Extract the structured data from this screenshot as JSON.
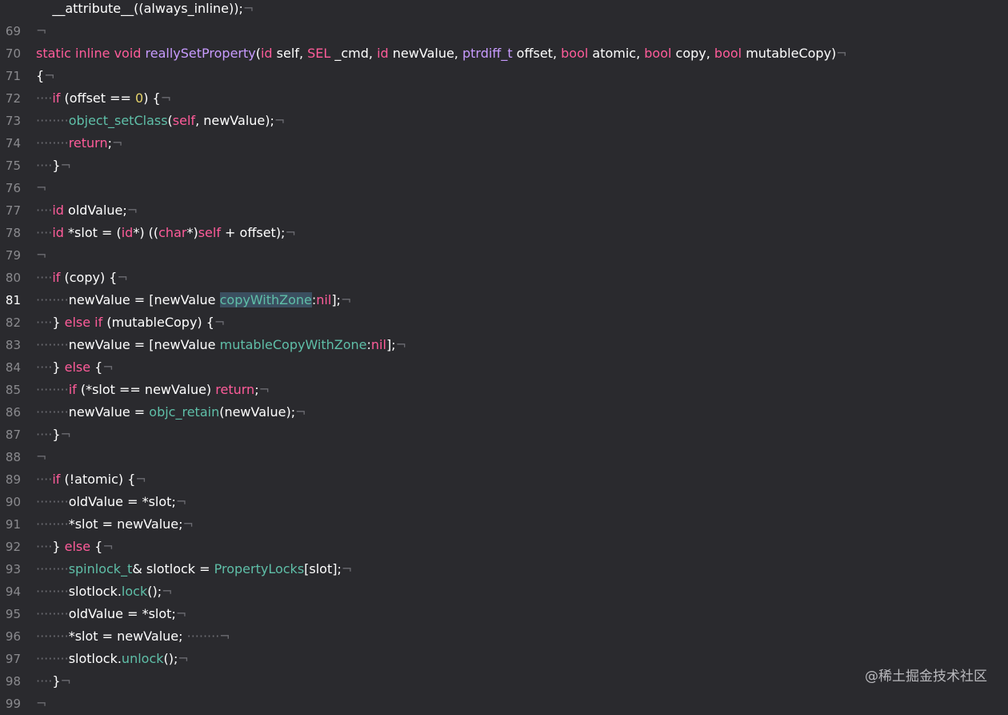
{
  "editor": {
    "current_line": "81",
    "lines": [
      {
        "n": "",
        "tokens": [
          {
            "t": "    __attribute__((always_inline));",
            "c": "pl"
          },
          {
            "t": "¬",
            "c": "inv"
          }
        ]
      },
      {
        "n": "69",
        "tokens": [
          {
            "t": "¬",
            "c": "inv"
          }
        ]
      },
      {
        "n": "70",
        "tokens": [
          {
            "t": "static inline void ",
            "c": "kw"
          },
          {
            "t": "reallySetProperty",
            "c": "ty"
          },
          {
            "t": "(",
            "c": "pl"
          },
          {
            "t": "id",
            "c": "kw"
          },
          {
            "t": " self, ",
            "c": "pl"
          },
          {
            "t": "SEL",
            "c": "kw"
          },
          {
            "t": " _cmd, ",
            "c": "pl"
          },
          {
            "t": "id",
            "c": "kw"
          },
          {
            "t": " newValue, ",
            "c": "pl"
          },
          {
            "t": "ptrdiff_t",
            "c": "ty"
          },
          {
            "t": " offset, ",
            "c": "pl"
          },
          {
            "t": "bool",
            "c": "kw"
          },
          {
            "t": " atomic, ",
            "c": "pl"
          },
          {
            "t": "bool",
            "c": "kw"
          },
          {
            "t": " copy, ",
            "c": "pl"
          },
          {
            "t": "bool",
            "c": "kw"
          },
          {
            "t": " mutableCopy)",
            "c": "pl"
          },
          {
            "t": "¬",
            "c": "inv"
          }
        ]
      },
      {
        "n": "71",
        "tokens": [
          {
            "t": "{",
            "c": "pl"
          },
          {
            "t": "¬",
            "c": "inv"
          }
        ]
      },
      {
        "n": "72",
        "tokens": [
          {
            "t": "····",
            "c": "inv"
          },
          {
            "t": "if",
            "c": "kw"
          },
          {
            "t": " (offset == ",
            "c": "pl"
          },
          {
            "t": "0",
            "c": "num"
          },
          {
            "t": ") {",
            "c": "pl"
          },
          {
            "t": "¬",
            "c": "inv"
          }
        ]
      },
      {
        "n": "73",
        "tokens": [
          {
            "t": "········",
            "c": "inv"
          },
          {
            "t": "object_setClass",
            "c": "fn"
          },
          {
            "t": "(",
            "c": "pl"
          },
          {
            "t": "self",
            "c": "kw"
          },
          {
            "t": ", newValue);",
            "c": "pl"
          },
          {
            "t": "¬",
            "c": "inv"
          }
        ]
      },
      {
        "n": "74",
        "tokens": [
          {
            "t": "········",
            "c": "inv"
          },
          {
            "t": "return",
            "c": "kw"
          },
          {
            "t": ";",
            "c": "pl"
          },
          {
            "t": "¬",
            "c": "inv"
          }
        ]
      },
      {
        "n": "75",
        "tokens": [
          {
            "t": "····",
            "c": "inv"
          },
          {
            "t": "}",
            "c": "pl"
          },
          {
            "t": "¬",
            "c": "inv"
          }
        ]
      },
      {
        "n": "76",
        "tokens": [
          {
            "t": "¬",
            "c": "inv"
          }
        ]
      },
      {
        "n": "77",
        "tokens": [
          {
            "t": "····",
            "c": "inv"
          },
          {
            "t": "id",
            "c": "kw"
          },
          {
            "t": " oldValue;",
            "c": "pl"
          },
          {
            "t": "¬",
            "c": "inv"
          }
        ]
      },
      {
        "n": "78",
        "tokens": [
          {
            "t": "····",
            "c": "inv"
          },
          {
            "t": "id",
            "c": "kw"
          },
          {
            "t": " *slot = (",
            "c": "pl"
          },
          {
            "t": "id",
            "c": "kw"
          },
          {
            "t": "*) ((",
            "c": "pl"
          },
          {
            "t": "char",
            "c": "kw"
          },
          {
            "t": "*)",
            "c": "pl"
          },
          {
            "t": "self",
            "c": "kw"
          },
          {
            "t": " + offset);",
            "c": "pl"
          },
          {
            "t": "¬",
            "c": "inv"
          }
        ]
      },
      {
        "n": "79",
        "tokens": [
          {
            "t": "¬",
            "c": "inv"
          }
        ]
      },
      {
        "n": "80",
        "tokens": [
          {
            "t": "····",
            "c": "inv"
          },
          {
            "t": "if",
            "c": "kw"
          },
          {
            "t": " (copy) {",
            "c": "pl"
          },
          {
            "t": "¬",
            "c": "inv"
          }
        ]
      },
      {
        "n": "81",
        "tokens": [
          {
            "t": "········",
            "c": "inv"
          },
          {
            "t": "newValue = [newValue ",
            "c": "pl"
          },
          {
            "t": "copyWithZone",
            "c": "fn sel"
          },
          {
            "t": ":",
            "c": "pl"
          },
          {
            "t": "nil",
            "c": "kw"
          },
          {
            "t": "];",
            "c": "pl"
          },
          {
            "t": "¬",
            "c": "inv"
          }
        ]
      },
      {
        "n": "82",
        "tokens": [
          {
            "t": "····",
            "c": "inv"
          },
          {
            "t": "} ",
            "c": "pl"
          },
          {
            "t": "else if",
            "c": "kw"
          },
          {
            "t": " (mutableCopy) {",
            "c": "pl"
          },
          {
            "t": "¬",
            "c": "inv"
          }
        ]
      },
      {
        "n": "83",
        "tokens": [
          {
            "t": "········",
            "c": "inv"
          },
          {
            "t": "newValue = [newValue ",
            "c": "pl"
          },
          {
            "t": "mutableCopyWithZone",
            "c": "fn"
          },
          {
            "t": ":",
            "c": "pl"
          },
          {
            "t": "nil",
            "c": "kw"
          },
          {
            "t": "];",
            "c": "pl"
          },
          {
            "t": "¬",
            "c": "inv"
          }
        ]
      },
      {
        "n": "84",
        "tokens": [
          {
            "t": "····",
            "c": "inv"
          },
          {
            "t": "} ",
            "c": "pl"
          },
          {
            "t": "else",
            "c": "kw"
          },
          {
            "t": " {",
            "c": "pl"
          },
          {
            "t": "¬",
            "c": "inv"
          }
        ]
      },
      {
        "n": "85",
        "tokens": [
          {
            "t": "········",
            "c": "inv"
          },
          {
            "t": "if",
            "c": "kw"
          },
          {
            "t": " (*slot == newValue) ",
            "c": "pl"
          },
          {
            "t": "return",
            "c": "kw"
          },
          {
            "t": ";",
            "c": "pl"
          },
          {
            "t": "¬",
            "c": "inv"
          }
        ]
      },
      {
        "n": "86",
        "tokens": [
          {
            "t": "········",
            "c": "inv"
          },
          {
            "t": "newValue = ",
            "c": "pl"
          },
          {
            "t": "objc_retain",
            "c": "fn"
          },
          {
            "t": "(newValue);",
            "c": "pl"
          },
          {
            "t": "¬",
            "c": "inv"
          }
        ]
      },
      {
        "n": "87",
        "tokens": [
          {
            "t": "····",
            "c": "inv"
          },
          {
            "t": "}",
            "c": "pl"
          },
          {
            "t": "¬",
            "c": "inv"
          }
        ]
      },
      {
        "n": "88",
        "tokens": [
          {
            "t": "¬",
            "c": "inv"
          }
        ]
      },
      {
        "n": "89",
        "tokens": [
          {
            "t": "····",
            "c": "inv"
          },
          {
            "t": "if",
            "c": "kw"
          },
          {
            "t": " (!atomic) {",
            "c": "pl"
          },
          {
            "t": "¬",
            "c": "inv"
          }
        ]
      },
      {
        "n": "90",
        "tokens": [
          {
            "t": "········",
            "c": "inv"
          },
          {
            "t": "oldValue = *slot;",
            "c": "pl"
          },
          {
            "t": "¬",
            "c": "inv"
          }
        ]
      },
      {
        "n": "91",
        "tokens": [
          {
            "t": "········",
            "c": "inv"
          },
          {
            "t": "*slot = newValue;",
            "c": "pl"
          },
          {
            "t": "¬",
            "c": "inv"
          }
        ]
      },
      {
        "n": "92",
        "tokens": [
          {
            "t": "····",
            "c": "inv"
          },
          {
            "t": "} ",
            "c": "pl"
          },
          {
            "t": "else",
            "c": "kw"
          },
          {
            "t": " {",
            "c": "pl"
          },
          {
            "t": "¬",
            "c": "inv"
          }
        ]
      },
      {
        "n": "93",
        "tokens": [
          {
            "t": "········",
            "c": "inv"
          },
          {
            "t": "spinlock_t",
            "c": "fn"
          },
          {
            "t": "& slotlock = ",
            "c": "pl"
          },
          {
            "t": "PropertyLocks",
            "c": "fn"
          },
          {
            "t": "[slot];",
            "c": "pl"
          },
          {
            "t": "¬",
            "c": "inv"
          }
        ]
      },
      {
        "n": "94",
        "tokens": [
          {
            "t": "········",
            "c": "inv"
          },
          {
            "t": "slotlock.",
            "c": "pl"
          },
          {
            "t": "lock",
            "c": "fn"
          },
          {
            "t": "();",
            "c": "pl"
          },
          {
            "t": "¬",
            "c": "inv"
          }
        ]
      },
      {
        "n": "95",
        "tokens": [
          {
            "t": "········",
            "c": "inv"
          },
          {
            "t": "oldValue = *slot;",
            "c": "pl"
          },
          {
            "t": "¬",
            "c": "inv"
          }
        ]
      },
      {
        "n": "96",
        "tokens": [
          {
            "t": "········",
            "c": "inv"
          },
          {
            "t": "*slot = newValue;",
            "c": "pl"
          },
          {
            "t": " ········¬",
            "c": "inv"
          }
        ]
      },
      {
        "n": "97",
        "tokens": [
          {
            "t": "········",
            "c": "inv"
          },
          {
            "t": "slotlock.",
            "c": "pl"
          },
          {
            "t": "unlock",
            "c": "fn"
          },
          {
            "t": "();",
            "c": "pl"
          },
          {
            "t": "¬",
            "c": "inv"
          }
        ]
      },
      {
        "n": "98",
        "tokens": [
          {
            "t": "····",
            "c": "inv"
          },
          {
            "t": "}",
            "c": "pl"
          },
          {
            "t": "¬",
            "c": "inv"
          }
        ]
      },
      {
        "n": "99",
        "tokens": [
          {
            "t": "¬",
            "c": "inv"
          }
        ]
      }
    ]
  },
  "watermark": "@稀土掘金技术社区"
}
